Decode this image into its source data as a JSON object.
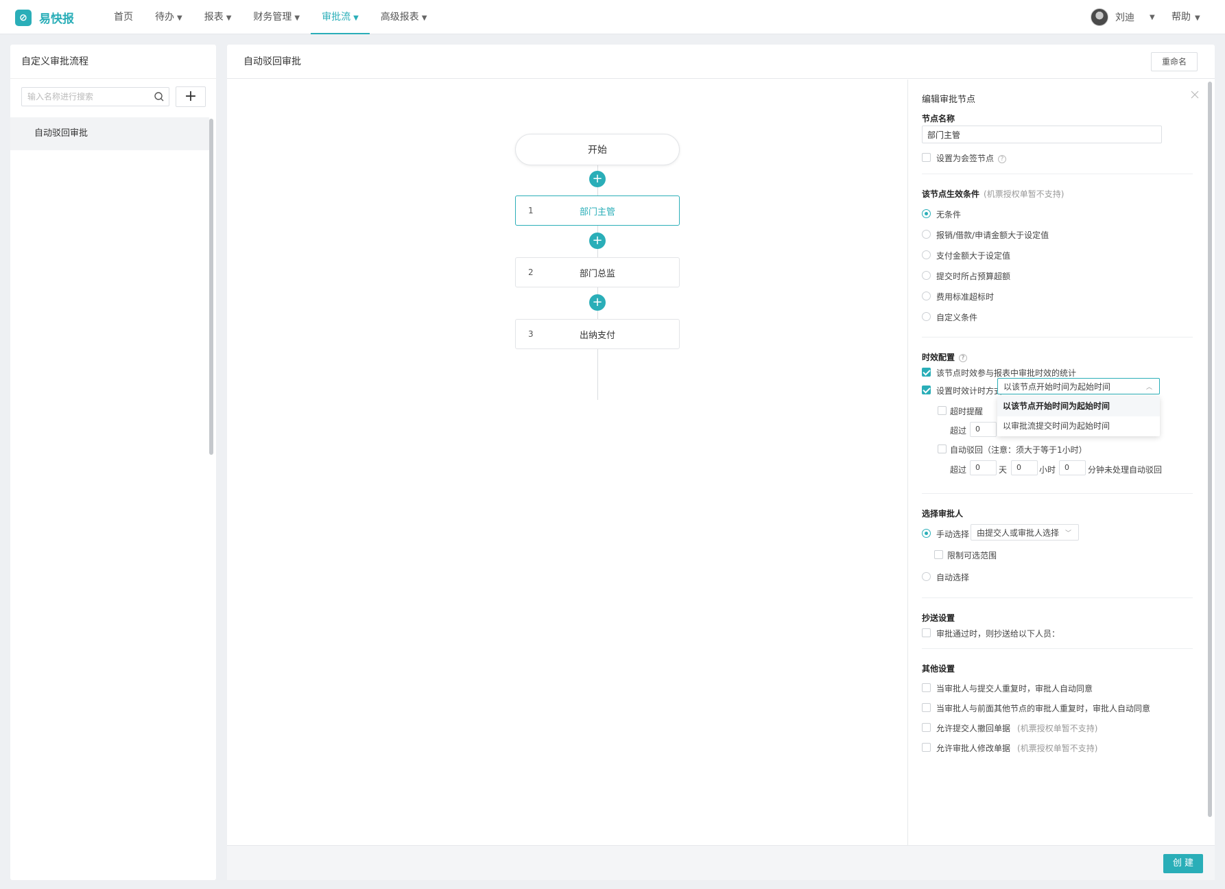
{
  "app": {
    "name": "易快报",
    "logo_glyph": "⊘",
    "accent": "#2aaeb8"
  },
  "nav": [
    {
      "label": "首页",
      "caret": false,
      "active": false
    },
    {
      "label": "待办",
      "caret": true,
      "active": false
    },
    {
      "label": "报表",
      "caret": true,
      "active": false
    },
    {
      "label": "财务管理",
      "caret": true,
      "active": false
    },
    {
      "label": "审批流",
      "caret": true,
      "active": true
    },
    {
      "label": "高级报表",
      "caret": true,
      "active": false
    }
  ],
  "user": {
    "name": "刘迪"
  },
  "help": {
    "label": "帮助"
  },
  "left": {
    "title": "自定义审批流程",
    "search_placeholder": "输入名称进行搜索",
    "add_label": "+",
    "items": [
      "自动驳回审批"
    ]
  },
  "main": {
    "title": "自动驳回审批",
    "rename_label": "重命名",
    "create_label": "创 建"
  },
  "flow": {
    "start_label": "开始",
    "nodes": [
      {
        "num": "1",
        "name": "部门主管",
        "active": true
      },
      {
        "num": "2",
        "name": "部门总监",
        "active": false
      },
      {
        "num": "3",
        "name": "出纳支付",
        "active": false
      }
    ]
  },
  "panel": {
    "title": "编辑审批节点",
    "node_name_label": "节点名称",
    "node_name_value": "部门主管",
    "countersign_label": "设置为会签节点",
    "condition": {
      "title": "该节点生效条件",
      "note": "(机票授权单暂不支持)",
      "options": [
        {
          "label": "无条件",
          "selected": true
        },
        {
          "label": "报销/借款/申请金额大于设定值",
          "selected": false
        },
        {
          "label": "支付金额大于设定值",
          "selected": false
        },
        {
          "label": "提交时所占预算超额",
          "selected": false
        },
        {
          "label": "费用标准超标时",
          "selected": false
        },
        {
          "label": "自定义条件",
          "selected": false
        }
      ]
    },
    "timing": {
      "title": "时效配置",
      "stat_label": "该节点时效参与报表中审批时效的统计",
      "stat_checked": true,
      "mode_label": "设置时效计时方式",
      "mode_checked": true,
      "mode_value": "以该节点开始时间为起始时间",
      "mode_options": [
        "以该节点开始时间为起始时间",
        "以审批流提交时间为起始时间"
      ],
      "overtime_label": "超时提醒",
      "over_label": "超过",
      "overtime_value": "0",
      "auto_reject_label": "自动驳回（注意：须大于等于1小时）",
      "days_value": "0",
      "days_unit": "天",
      "hours_value": "0",
      "hours_unit": "小时",
      "minutes_value": "0",
      "minutes_suffix": "分钟未处理自动驳回"
    },
    "approver": {
      "title": "选择审批人",
      "manual_label": "手动选择",
      "manual_selected": true,
      "manual_select_value": "由提交人或审批人选择",
      "limit_label": "限制可选范围",
      "auto_label": "自动选择"
    },
    "cc": {
      "title": "抄送设置",
      "label": "审批通过时，则抄送给以下人员："
    },
    "other": {
      "title": "其他设置",
      "items": [
        {
          "label": "当审批人与提交人重复时，审批人自动同意",
          "note": ""
        },
        {
          "label": "当审批人与前面其他节点的审批人重复时，审批人自动同意",
          "note": ""
        },
        {
          "label": "允许提交人撤回单据",
          "note": "(机票授权单暂不支持)"
        },
        {
          "label": "允许审批人修改单据",
          "note": "(机票授权单暂不支持)"
        }
      ]
    }
  }
}
